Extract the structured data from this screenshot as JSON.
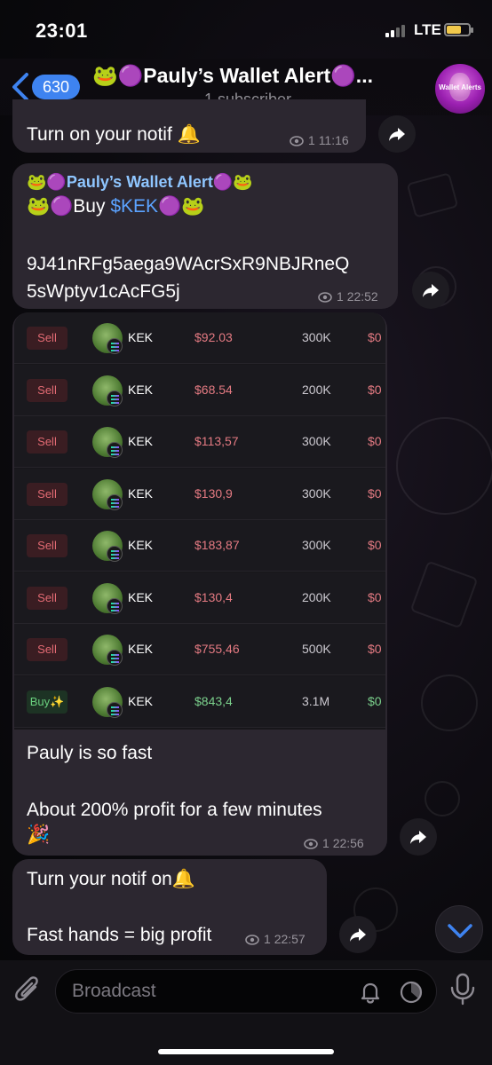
{
  "status_bar": {
    "time": "23:01",
    "network": "LTE"
  },
  "header": {
    "unread_count": "630",
    "title": "🐸🟣Pauly’s Wallet Alert🟣...",
    "subtitle": "1 subscriber",
    "avatar_text": "Wallet Alerts"
  },
  "messages": [
    {
      "text": "Turn on your notif 🔔",
      "views": "1",
      "time": "11:16"
    },
    {
      "sender": "🐸🟣Pauly’s Wallet Alert🟣🐸",
      "line_prefix": "🐸🟣Buy ",
      "ticker": "$KEK",
      "line_suffix": "🟣🐸",
      "address_line1": "9J41nRFg5aega9WAcrSxR9NBJRneQ",
      "address_line2": "5sWptyv1cAcFG5j",
      "views": "1",
      "time": "22:52"
    },
    {
      "text_line1": "Pauly is so fast",
      "text_line2": "About 200% profit for a few minutes",
      "text_line3": "🎉",
      "views": "1",
      "time": "22:56"
    },
    {
      "text_line1": "Turn your notif on🔔",
      "text_line2": "Fast hands = big profit",
      "views": "1",
      "time": "22:57"
    }
  ],
  "trades": [
    {
      "side": "Sell",
      "token": "KEK",
      "price": "$92.03",
      "amount": "300K",
      "cut": "$0"
    },
    {
      "side": "Sell",
      "token": "KEK",
      "price": "$68.54",
      "amount": "200K",
      "cut": "$0"
    },
    {
      "side": "Sell",
      "token": "KEK",
      "price": "$113,57",
      "amount": "300K",
      "cut": "$0"
    },
    {
      "side": "Sell",
      "token": "KEK",
      "price": "$130,9",
      "amount": "300K",
      "cut": "$0"
    },
    {
      "side": "Sell",
      "token": "KEK",
      "price": "$183,87",
      "amount": "300K",
      "cut": "$0"
    },
    {
      "side": "Sell",
      "token": "KEK",
      "price": "$130,4",
      "amount": "200K",
      "cut": "$0"
    },
    {
      "side": "Sell",
      "token": "KEK",
      "price": "$755,46",
      "amount": "500K",
      "cut": "$0"
    },
    {
      "side": "Buy✨",
      "token": "KEK",
      "price": "$843,4",
      "amount": "3.1M",
      "cut": "$0"
    }
  ],
  "input": {
    "placeholder": "Broadcast"
  },
  "colors": {
    "accent": "#3e83f0",
    "bubble": "#2c2730",
    "sell": "#e26a73",
    "buy": "#6ad07e"
  },
  "icons": [
    "back-chevron-icon",
    "eye-icon",
    "forward-icon",
    "attach-icon",
    "bell-icon",
    "schedule-icon",
    "mic-icon",
    "chevron-down-icon"
  ]
}
